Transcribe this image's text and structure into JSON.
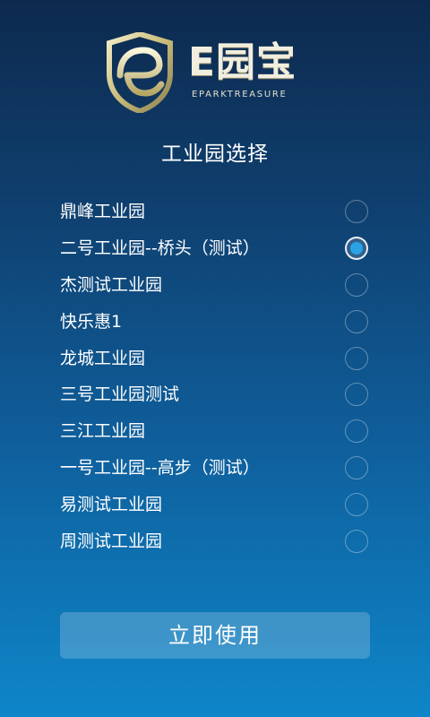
{
  "logo": {
    "title": "E园宝",
    "subtitle": "EPARKTREASURE"
  },
  "heading": "工业园选择",
  "parks": [
    {
      "label": "鼎峰工业园",
      "selected": false
    },
    {
      "label": "二号工业园--桥头（测试）",
      "selected": true
    },
    {
      "label": "杰测试工业园",
      "selected": false
    },
    {
      "label": "快乐惠1",
      "selected": false
    },
    {
      "label": "龙城工业园",
      "selected": false
    },
    {
      "label": "三号工业园测试",
      "selected": false
    },
    {
      "label": "三江工业园",
      "selected": false
    },
    {
      "label": "一号工业园--高步（测试）",
      "selected": false
    },
    {
      "label": "易测试工业园",
      "selected": false
    },
    {
      "label": "周测试工业园",
      "selected": false
    }
  ],
  "button": {
    "label": "立即使用"
  },
  "colors": {
    "background_top": "#0d2a4e",
    "background_bottom": "#0e86c9",
    "radio_selected": "#29a3e6",
    "logo_gold": "#d4c896"
  },
  "icons": {
    "logo": "e-shield-logo-icon",
    "radio_selected": "radio-checked-icon",
    "radio_unselected": "radio-unchecked-icon"
  }
}
